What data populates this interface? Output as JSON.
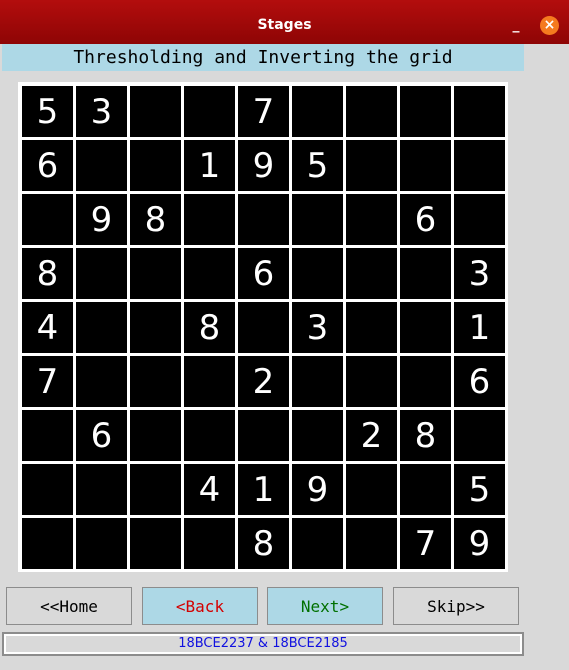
{
  "window": {
    "title": "Stages",
    "minimize_label": "_",
    "close_label": "×"
  },
  "heading": "Thresholding and Inverting the grid",
  "grid": [
    [
      "5",
      "3",
      "",
      "",
      "7",
      "",
      "",
      "",
      ""
    ],
    [
      "6",
      "",
      "",
      "1",
      "9",
      "5",
      "",
      "",
      ""
    ],
    [
      "",
      "9",
      "8",
      "",
      "",
      "",
      "",
      "6",
      ""
    ],
    [
      "8",
      "",
      "",
      "",
      "6",
      "",
      "",
      "",
      "3"
    ],
    [
      "4",
      "",
      "",
      "8",
      "",
      "3",
      "",
      "",
      "1"
    ],
    [
      "7",
      "",
      "",
      "",
      "2",
      "",
      "",
      "",
      "6"
    ],
    [
      "",
      "6",
      "",
      "",
      "",
      "",
      "2",
      "8",
      ""
    ],
    [
      "",
      "",
      "",
      "4",
      "1",
      "9",
      "",
      "",
      "5"
    ],
    [
      "",
      "",
      "",
      "",
      "8",
      "",
      "",
      "7",
      "9"
    ]
  ],
  "buttons": {
    "home": "<<Home",
    "back": "<Back",
    "next": "Next>",
    "skip": "Skip>>"
  },
  "footer": "18BCE2237 & 18BCE2185"
}
